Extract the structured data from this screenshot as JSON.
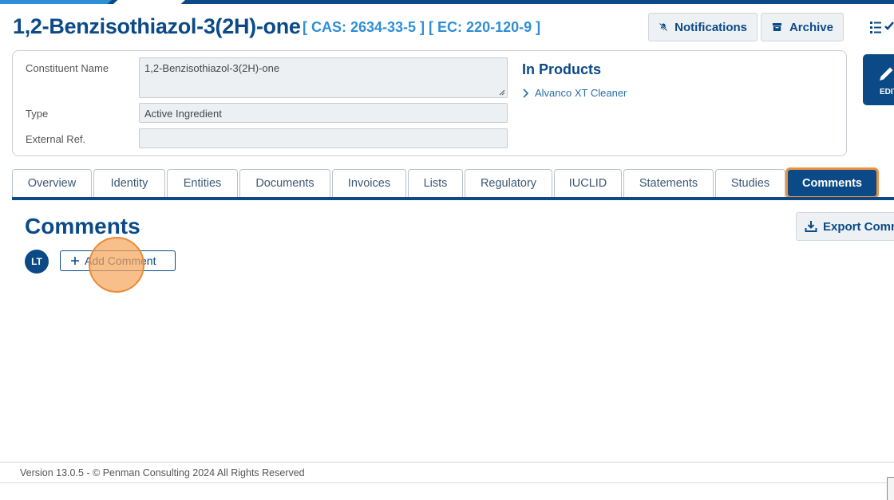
{
  "colors": {
    "brand_dark": "#0b4a87",
    "brand_light": "#2f8fd6",
    "highlight": "#e9913f",
    "panel_border": "#c9ced4"
  },
  "header": {
    "title": "1,2-Benzisothiazol-3(2H)-one",
    "ids": "[ CAS: 2634-33-5 ] [ EC: 220-120-9 ]",
    "notifications_label": "Notifications",
    "archive_label": "Archive",
    "icons": [
      "bell-slash-icon",
      "archive-box-icon",
      "list-check-icon"
    ]
  },
  "details": {
    "constituent_name_label": "Constituent Name",
    "constituent_name_value": "1,2-Benzisothiazol-3(2H)-one",
    "type_label": "Type",
    "type_value": "Active Ingredient",
    "external_ref_label": "External Ref.",
    "external_ref_value": ""
  },
  "products": {
    "heading": "In Products",
    "items": [
      "Alvanco XT Cleaner"
    ]
  },
  "edit_button_label": "EDIT",
  "tabs": [
    {
      "label": "Overview",
      "active": false
    },
    {
      "label": "Identity",
      "active": false
    },
    {
      "label": "Entities",
      "active": false
    },
    {
      "label": "Documents",
      "active": false
    },
    {
      "label": "Invoices",
      "active": false
    },
    {
      "label": "Lists",
      "active": false
    },
    {
      "label": "Regulatory",
      "active": false
    },
    {
      "label": "IUCLID",
      "active": false
    },
    {
      "label": "Statements",
      "active": false
    },
    {
      "label": "Studies",
      "active": false
    },
    {
      "label": "Comments",
      "active": true
    }
  ],
  "comments": {
    "heading": "Comments",
    "export_label": "Export Comments",
    "avatar_initials": "LT",
    "add_comment_label": "Add Comment"
  },
  "footer": {
    "text": "Version 13.0.5 - © Penman Consulting 2024 All Rights Reserved"
  }
}
